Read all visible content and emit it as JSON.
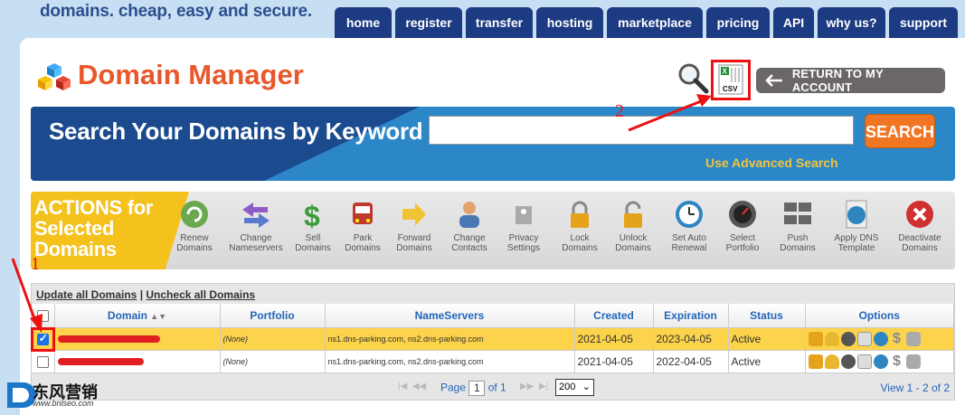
{
  "tagline": "domains. cheap, easy and secure.",
  "nav": [
    "home",
    "register",
    "transfer",
    "hosting",
    "marketplace",
    "pricing",
    "API",
    "why us?",
    "support"
  ],
  "page_title": "Domain Manager",
  "return_label": "RETURN TO MY ACCOUNT",
  "csv_label": "CSV",
  "search": {
    "label": "Search Your Domains by Keyword",
    "value": "",
    "button": "SEARCH",
    "advanced": "Use Advanced Search"
  },
  "actions": {
    "title_lines": [
      "ACTIONS for",
      "Selected",
      "Domains"
    ],
    "items": [
      {
        "label1": "Renew",
        "label2": "Domains",
        "icon": "renew-icon",
        "color": "#6aa84f"
      },
      {
        "label1": "Change",
        "label2": "Nameservers",
        "icon": "swap-arrows-icon",
        "color": "#8e5cc5"
      },
      {
        "label1": "Sell",
        "label2": "Domains",
        "icon": "dollar-icon",
        "color": "#3a9d3a"
      },
      {
        "label1": "Park",
        "label2": "Domains",
        "icon": "car-icon",
        "color": "#c0392b"
      },
      {
        "label1": "Forward",
        "label2": "Domains",
        "icon": "forward-arrow-icon",
        "color": "#f1c232"
      },
      {
        "label1": "Change",
        "label2": "Contacts",
        "icon": "contacts-icon",
        "color": "#4a78b5"
      },
      {
        "label1": "Privacy",
        "label2": "Settings",
        "icon": "privacy-tag-icon",
        "color": "#aaaaaa"
      },
      {
        "label1": "Lock",
        "label2": "Domains",
        "icon": "lock-icon",
        "color": "#e5a31c"
      },
      {
        "label1": "Unlock",
        "label2": "Domains",
        "icon": "unlock-icon",
        "color": "#e5a31c"
      },
      {
        "label1": "Set Auto",
        "label2": "Renewal",
        "icon": "clock-icon",
        "color": "#2e86c1"
      },
      {
        "label1": "Select",
        "label2": "Portfolio",
        "icon": "gauge-icon",
        "color": "#555555"
      },
      {
        "label1": "Push",
        "label2": "Domains",
        "icon": "servers-icon",
        "color": "#666666"
      },
      {
        "label1": "Apply DNS",
        "label2": "Template",
        "icon": "globe-doc-icon",
        "color": "#2e86c1"
      },
      {
        "label1": "Deactivate",
        "label2": "Domains",
        "icon": "deactivate-icon",
        "color": "#d03030"
      }
    ]
  },
  "table": {
    "update_all": "Update all Domains",
    "separator": " | ",
    "uncheck_all": "Uncheck all Domains",
    "headers": [
      "Domain",
      "Portfolio",
      "NameServers",
      "Created",
      "Expiration",
      "Status",
      "Options"
    ],
    "sort_icon": "▲▼",
    "rows": [
      {
        "portfolio": "(None)",
        "nameservers": "ns1.dns-parking.com, ns2.dns-parking.com",
        "created": "2021-04-05",
        "expiration": "2023-04-05",
        "status": "Active",
        "checked": true
      },
      {
        "portfolio": "(None)",
        "nameservers": "ns1.dns-parking.com, ns2.dns-parking.com",
        "created": "2021-04-05",
        "expiration": "2022-04-05",
        "status": "Active",
        "checked": false
      }
    ],
    "pager": {
      "page_label": "Page",
      "page_value": "1",
      "of_label": "of 1",
      "per_page": "200",
      "view": "View 1 - 2 of 2"
    }
  },
  "annotations": {
    "label1": "1",
    "label2": "2"
  },
  "watermark": {
    "text": "东风营销",
    "sub": "www.bnlseo.com"
  }
}
